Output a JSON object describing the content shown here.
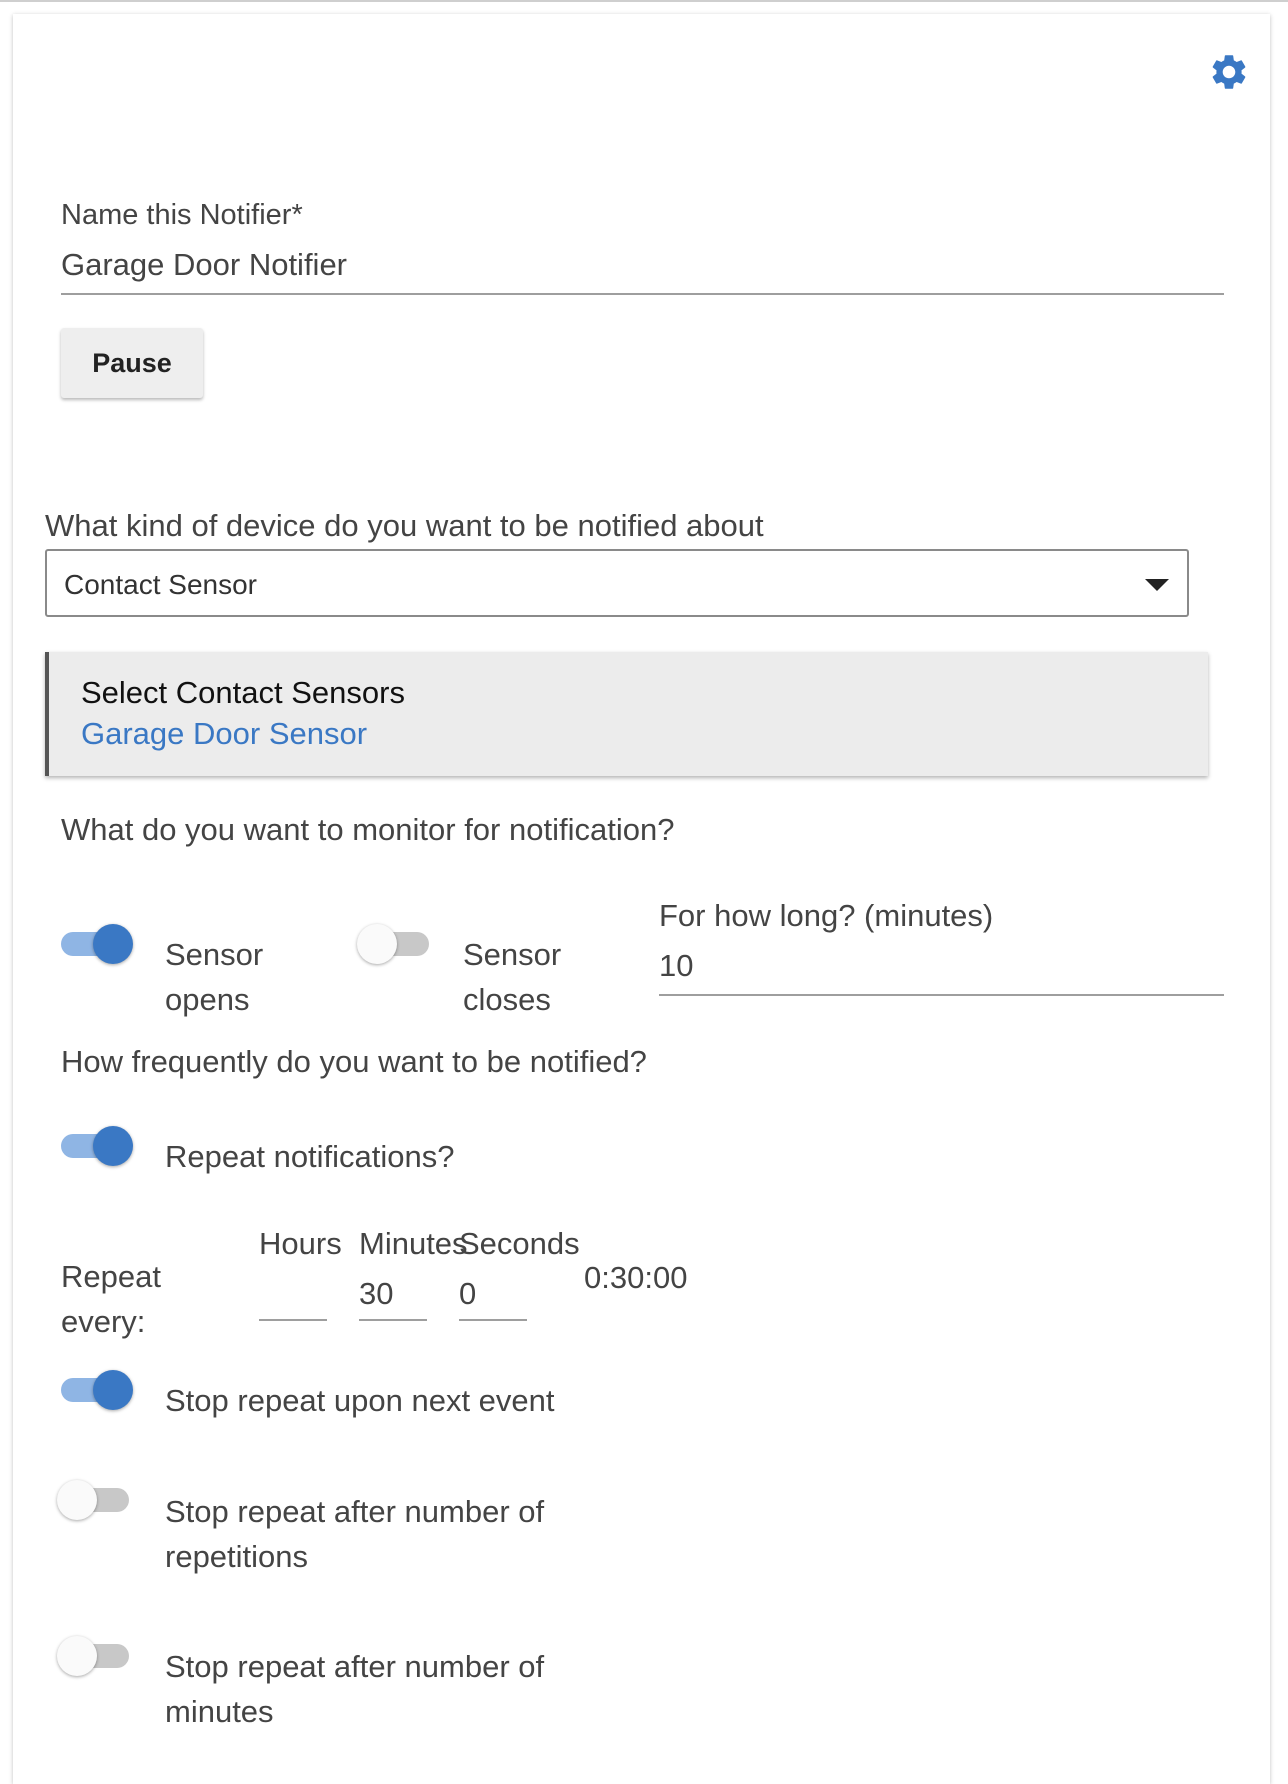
{
  "settings": {
    "icon": "gear-icon",
    "color": "#3a78c4"
  },
  "name_field": {
    "label": "Name this Notifier*",
    "value": "Garage Door Notifier"
  },
  "pause_button": {
    "label": "Pause"
  },
  "device_type": {
    "question": "What kind of device do you want to be notified about",
    "selected": "Contact Sensor"
  },
  "device_select": {
    "title": "Select Contact Sensors",
    "selected_device": "Garage Door Sensor"
  },
  "monitor": {
    "question": "What do you want to monitor for notification?",
    "sensor_opens": {
      "label_line1": "Sensor",
      "label_line2": "opens",
      "on": true
    },
    "sensor_closes": {
      "label_line1": "Sensor",
      "label_line2": "closes",
      "on": false
    },
    "duration_label": "For how long? (minutes)",
    "duration_value": "10"
  },
  "frequency": {
    "question": "How frequently do you want to be notified?",
    "repeat_notifications": {
      "label": "Repeat notifications?",
      "on": true
    },
    "repeat_every": {
      "label_line1": "Repeat",
      "label_line2": "every:",
      "hours_label": "Hours",
      "minutes_label": "Minutes",
      "seconds_label": "Seconds",
      "hours_value": "",
      "minutes_value": "30",
      "seconds_value": "0",
      "total": "0:30:00"
    },
    "stop_next_event": {
      "label": "Stop repeat upon next event",
      "on": true
    },
    "stop_repetitions": {
      "label_line1": "Stop repeat after number of",
      "label_line2": "repetitions",
      "on": false
    },
    "stop_minutes": {
      "label_line1": "Stop repeat after number of",
      "label_line2": "minutes",
      "on": false
    }
  },
  "colors": {
    "accent": "#3a78c4",
    "toggle_track_on": "#8fb5e4",
    "toggle_track_off": "#c8c8c8",
    "panel_bg": "#ececec"
  }
}
